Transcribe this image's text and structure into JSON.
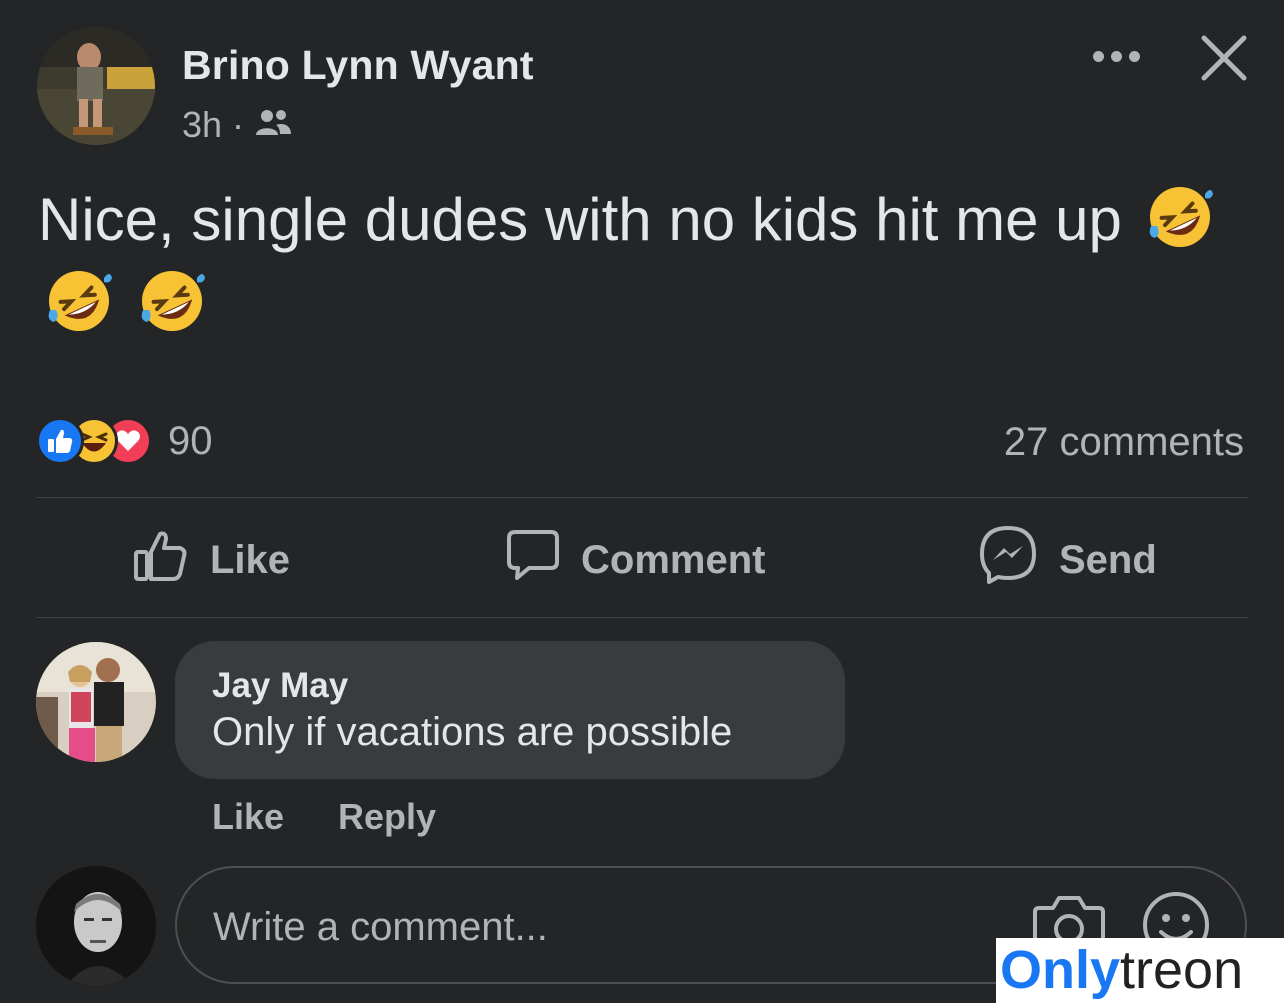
{
  "post": {
    "author_name": "Brino Lynn Wyant",
    "timestamp": "3h",
    "separator": "·",
    "audience_icon": "friends-icon",
    "text": "Nice, single dudes with no kids hit me up",
    "emojis": [
      "rolling-on-floor-laughing",
      "rolling-on-floor-laughing",
      "rolling-on-floor-laughing"
    ]
  },
  "header_actions": {
    "more_icon": "more-horizontal-icon",
    "close_icon": "close-icon"
  },
  "stats": {
    "reactions": [
      "like",
      "haha",
      "love"
    ],
    "reaction_count": "90",
    "comment_count": "27 comments"
  },
  "actions": {
    "like_label": "Like",
    "comment_label": "Comment",
    "send_label": "Send"
  },
  "comment": {
    "author": "Jay May",
    "text": "Only if vacations are possible",
    "like_label": "Like",
    "reply_label": "Reply"
  },
  "composer": {
    "placeholder": "Write a comment..."
  },
  "watermark": {
    "part1": "Only",
    "part2": "treon"
  },
  "colors": {
    "background": "#242526",
    "bubble": "#3a3b3c",
    "text_primary": "#e4e6eb",
    "text_secondary": "#b0b3b8",
    "like_blue": "#1877f2",
    "love_red": "#f33e58",
    "haha_yellow": "#f7b125"
  }
}
